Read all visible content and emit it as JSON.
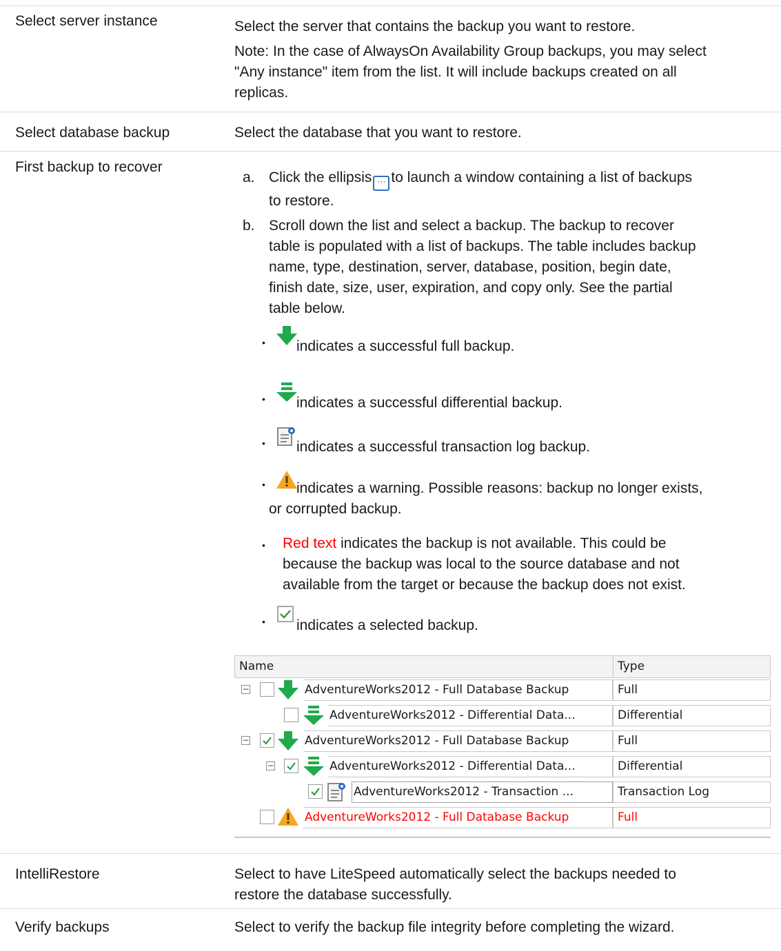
{
  "rows": {
    "server": {
      "label": "Select server instance",
      "desc": "Select the server that contains the backup you want to restore.",
      "note_line1": "Note: In the case of AlwaysOn Availability Group backups, you may select",
      "note_line2": "\"Any instance\" item from the list. It will include backups created on all",
      "note_line3": "replicas."
    },
    "database": {
      "label": "Select database backup",
      "desc": "Select the database that you want to restore."
    },
    "first_backup": {
      "label": "First backup to recover",
      "step_a_marker": "a.",
      "step_a_before": "Click the ellipsis",
      "step_a_after": "to launch a window containing a list of backups",
      "step_a_line2": "to restore.",
      "step_b_marker": "b.",
      "step_b_line1": "Scroll down the list and select a backup. The backup to recover",
      "step_b_line2": "table is populated with a list of backups. The table includes backup",
      "step_b_line3": "name, type, destination, server, database, position, begin date,",
      "step_b_line4": "finish date, size, user, expiration, and copy only. See the partial",
      "step_b_line5": "table below.",
      "bullet_full": "indicates a successful full backup.",
      "bullet_diff": "indicates a successful differential backup.",
      "bullet_log": "indicates a successful transaction log backup.",
      "bullet_warn_line1": "indicates a warning. Possible reasons: backup no longer exists,",
      "bullet_warn_line2": "or corrupted backup.",
      "bullet_red_word": "Red text",
      "bullet_red_line1": "indicates the backup is not available. This could be",
      "bullet_red_line2": "because the backup was local to the source database and not",
      "bullet_red_line3": "available from the target or because the backup does not exist.",
      "bullet_selected": "indicates a selected backup."
    },
    "intellirestore": {
      "label": "IntelliRestore",
      "line1": "Select to have LiteSpeed automatically select the backups needed to",
      "line2": "restore the database successfully."
    },
    "verify": {
      "label": "Verify backups",
      "desc": "Select to verify the backup file integrity before completing the wizard."
    }
  },
  "grid": {
    "col_name": "Name",
    "col_type": "Type",
    "rows": [
      {
        "name": "AdventureWorks2012 - Full Database Backup",
        "type": "Full",
        "icon": "full-backup-icon",
        "checked": false,
        "expander": true,
        "red": false
      },
      {
        "name": "AdventureWorks2012 - Differential Data...",
        "type": "Differential",
        "icon": "differential-backup-icon",
        "checked": false,
        "expander": false,
        "red": false
      },
      {
        "name": "AdventureWorks2012 - Full Database Backup",
        "type": "Full",
        "icon": "full-backup-icon",
        "checked": true,
        "expander": true,
        "red": false
      },
      {
        "name": "AdventureWorks2012 - Differential Data...",
        "type": "Differential",
        "icon": "differential-backup-icon",
        "checked": true,
        "expander": true,
        "red": false
      },
      {
        "name": "AdventureWorks2012 - Transaction ...",
        "type": "Transaction Log",
        "icon": "transaction-log-icon",
        "checked": true,
        "expander": false,
        "red": false
      },
      {
        "name": "AdventureWorks2012 - Full Database Backup",
        "type": "Full",
        "icon": "warning-icon",
        "checked": false,
        "expander": false,
        "red": true
      }
    ]
  },
  "colors": {
    "green": "#1faa4b",
    "red": "#ff0000",
    "warning": "#f5a623"
  }
}
